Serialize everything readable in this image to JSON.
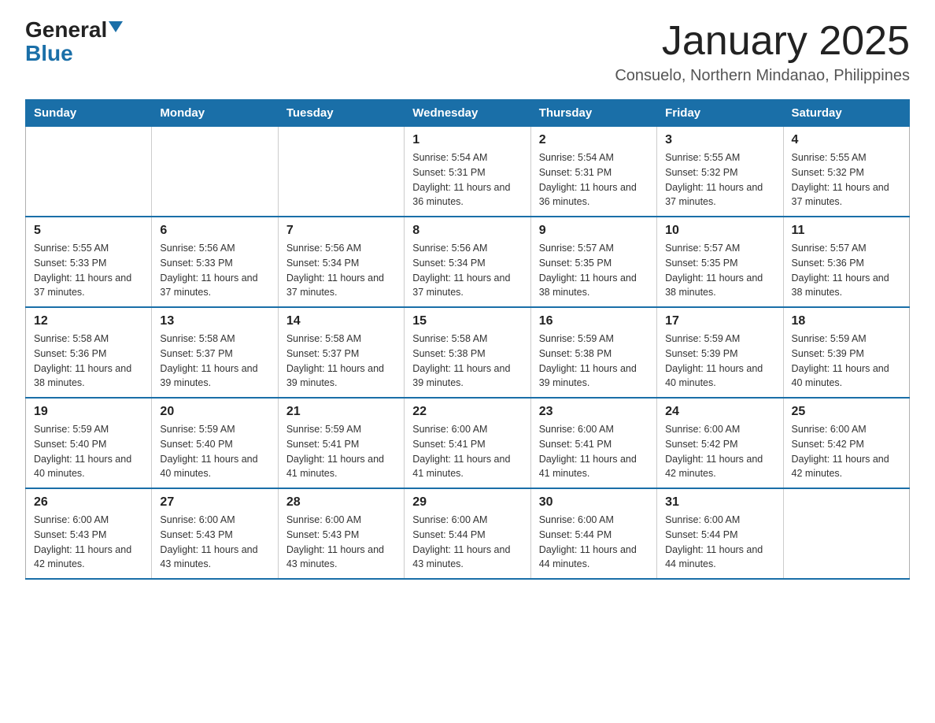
{
  "logo": {
    "text_general": "General",
    "text_blue": "Blue"
  },
  "title": "January 2025",
  "subtitle": "Consuelo, Northern Mindanao, Philippines",
  "days_of_week": [
    "Sunday",
    "Monday",
    "Tuesday",
    "Wednesday",
    "Thursday",
    "Friday",
    "Saturday"
  ],
  "weeks": [
    [
      {
        "day": "",
        "info": ""
      },
      {
        "day": "",
        "info": ""
      },
      {
        "day": "",
        "info": ""
      },
      {
        "day": "1",
        "info": "Sunrise: 5:54 AM\nSunset: 5:31 PM\nDaylight: 11 hours and 36 minutes."
      },
      {
        "day": "2",
        "info": "Sunrise: 5:54 AM\nSunset: 5:31 PM\nDaylight: 11 hours and 36 minutes."
      },
      {
        "day": "3",
        "info": "Sunrise: 5:55 AM\nSunset: 5:32 PM\nDaylight: 11 hours and 37 minutes."
      },
      {
        "day": "4",
        "info": "Sunrise: 5:55 AM\nSunset: 5:32 PM\nDaylight: 11 hours and 37 minutes."
      }
    ],
    [
      {
        "day": "5",
        "info": "Sunrise: 5:55 AM\nSunset: 5:33 PM\nDaylight: 11 hours and 37 minutes."
      },
      {
        "day": "6",
        "info": "Sunrise: 5:56 AM\nSunset: 5:33 PM\nDaylight: 11 hours and 37 minutes."
      },
      {
        "day": "7",
        "info": "Sunrise: 5:56 AM\nSunset: 5:34 PM\nDaylight: 11 hours and 37 minutes."
      },
      {
        "day": "8",
        "info": "Sunrise: 5:56 AM\nSunset: 5:34 PM\nDaylight: 11 hours and 37 minutes."
      },
      {
        "day": "9",
        "info": "Sunrise: 5:57 AM\nSunset: 5:35 PM\nDaylight: 11 hours and 38 minutes."
      },
      {
        "day": "10",
        "info": "Sunrise: 5:57 AM\nSunset: 5:35 PM\nDaylight: 11 hours and 38 minutes."
      },
      {
        "day": "11",
        "info": "Sunrise: 5:57 AM\nSunset: 5:36 PM\nDaylight: 11 hours and 38 minutes."
      }
    ],
    [
      {
        "day": "12",
        "info": "Sunrise: 5:58 AM\nSunset: 5:36 PM\nDaylight: 11 hours and 38 minutes."
      },
      {
        "day": "13",
        "info": "Sunrise: 5:58 AM\nSunset: 5:37 PM\nDaylight: 11 hours and 39 minutes."
      },
      {
        "day": "14",
        "info": "Sunrise: 5:58 AM\nSunset: 5:37 PM\nDaylight: 11 hours and 39 minutes."
      },
      {
        "day": "15",
        "info": "Sunrise: 5:58 AM\nSunset: 5:38 PM\nDaylight: 11 hours and 39 minutes."
      },
      {
        "day": "16",
        "info": "Sunrise: 5:59 AM\nSunset: 5:38 PM\nDaylight: 11 hours and 39 minutes."
      },
      {
        "day": "17",
        "info": "Sunrise: 5:59 AM\nSunset: 5:39 PM\nDaylight: 11 hours and 40 minutes."
      },
      {
        "day": "18",
        "info": "Sunrise: 5:59 AM\nSunset: 5:39 PM\nDaylight: 11 hours and 40 minutes."
      }
    ],
    [
      {
        "day": "19",
        "info": "Sunrise: 5:59 AM\nSunset: 5:40 PM\nDaylight: 11 hours and 40 minutes."
      },
      {
        "day": "20",
        "info": "Sunrise: 5:59 AM\nSunset: 5:40 PM\nDaylight: 11 hours and 40 minutes."
      },
      {
        "day": "21",
        "info": "Sunrise: 5:59 AM\nSunset: 5:41 PM\nDaylight: 11 hours and 41 minutes."
      },
      {
        "day": "22",
        "info": "Sunrise: 6:00 AM\nSunset: 5:41 PM\nDaylight: 11 hours and 41 minutes."
      },
      {
        "day": "23",
        "info": "Sunrise: 6:00 AM\nSunset: 5:41 PM\nDaylight: 11 hours and 41 minutes."
      },
      {
        "day": "24",
        "info": "Sunrise: 6:00 AM\nSunset: 5:42 PM\nDaylight: 11 hours and 42 minutes."
      },
      {
        "day": "25",
        "info": "Sunrise: 6:00 AM\nSunset: 5:42 PM\nDaylight: 11 hours and 42 minutes."
      }
    ],
    [
      {
        "day": "26",
        "info": "Sunrise: 6:00 AM\nSunset: 5:43 PM\nDaylight: 11 hours and 42 minutes."
      },
      {
        "day": "27",
        "info": "Sunrise: 6:00 AM\nSunset: 5:43 PM\nDaylight: 11 hours and 43 minutes."
      },
      {
        "day": "28",
        "info": "Sunrise: 6:00 AM\nSunset: 5:43 PM\nDaylight: 11 hours and 43 minutes."
      },
      {
        "day": "29",
        "info": "Sunrise: 6:00 AM\nSunset: 5:44 PM\nDaylight: 11 hours and 43 minutes."
      },
      {
        "day": "30",
        "info": "Sunrise: 6:00 AM\nSunset: 5:44 PM\nDaylight: 11 hours and 44 minutes."
      },
      {
        "day": "31",
        "info": "Sunrise: 6:00 AM\nSunset: 5:44 PM\nDaylight: 11 hours and 44 minutes."
      },
      {
        "day": "",
        "info": ""
      }
    ]
  ]
}
